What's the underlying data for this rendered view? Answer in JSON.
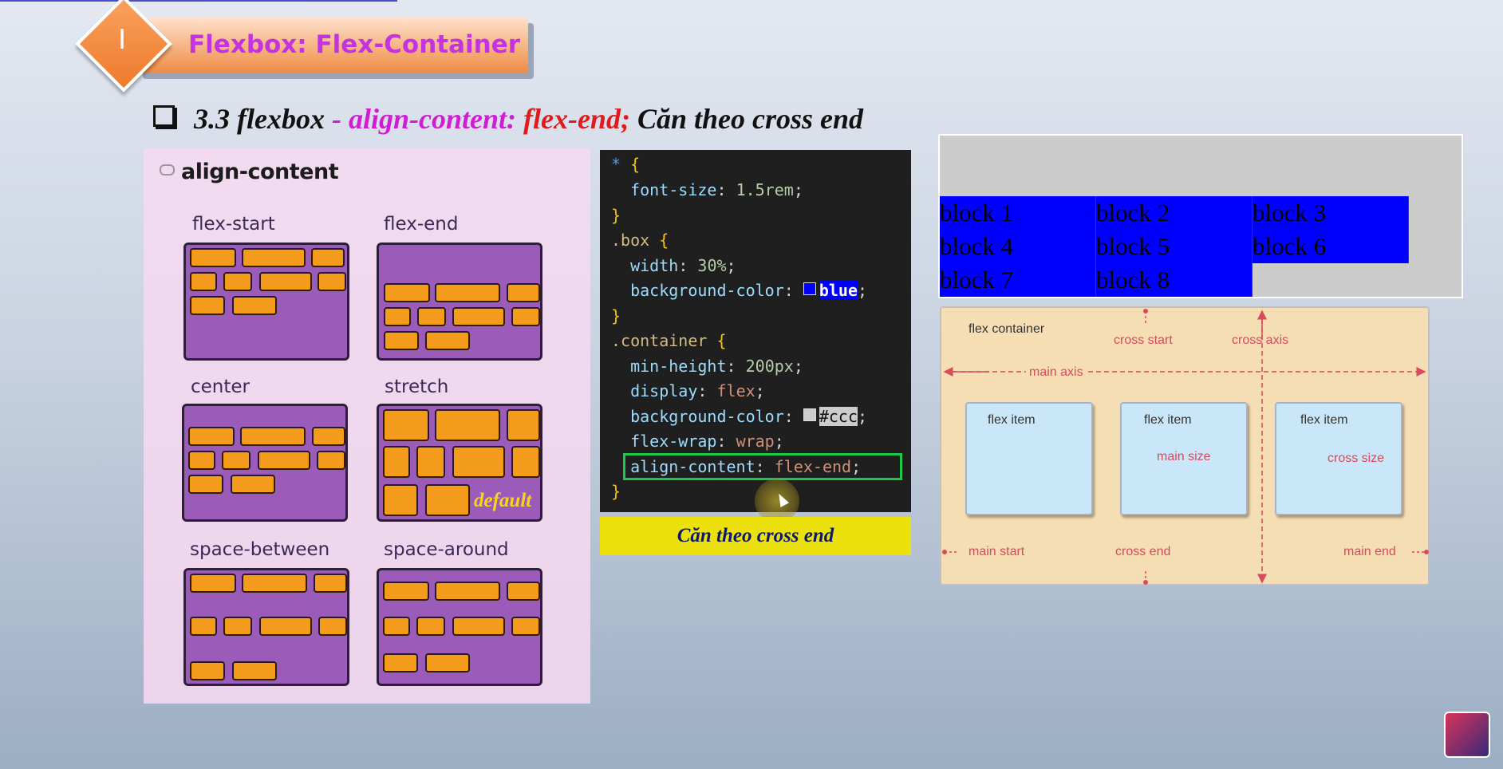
{
  "header": {
    "section_number": "I",
    "title": "Flexbox: Flex-Container"
  },
  "subtitle": {
    "prefix": "3.3 flexbox",
    "dash": " - ",
    "property": "align-content: ",
    "value": "flex-end;",
    "description": " Căn theo cross end"
  },
  "illustration": {
    "heading": "align-content",
    "panels": [
      {
        "label": "flex-start"
      },
      {
        "label": "flex-end"
      },
      {
        "label": "center"
      },
      {
        "label": "stretch",
        "note": "default"
      },
      {
        "label": "space-between"
      },
      {
        "label": "space-around"
      }
    ]
  },
  "code": {
    "lines": [
      {
        "sel": "* ",
        "brace": "{"
      },
      {
        "prop": "font-size",
        "val": "1.5rem"
      },
      {
        "brace": "}"
      },
      {
        "sel": ".box ",
        "brace": "{"
      },
      {
        "prop": "width",
        "val": "30%"
      },
      {
        "prop": "background-color",
        "val": "blue"
      },
      {
        "brace": "}"
      },
      {
        "sel": ".container ",
        "brace": "{"
      },
      {
        "prop": "min-height",
        "val": "200px"
      },
      {
        "prop": "display",
        "val": "flex"
      },
      {
        "prop": "background-color",
        "val": "#ccc"
      },
      {
        "prop": "flex-wrap",
        "val": "wrap"
      },
      {
        "prop": "align-content",
        "val": "flex-end"
      },
      {
        "brace": "}"
      }
    ],
    "caption": "Căn theo cross end"
  },
  "demo": {
    "blocks": [
      "block 1",
      "block 2",
      "block 3",
      "block 4",
      "block 5",
      "block 6",
      "block 7",
      "block 8"
    ],
    "container_color": "#cccccc",
    "block_color": "#0000ff"
  },
  "diagram": {
    "container_label": "flex container",
    "cross_start": "cross start",
    "cross_axis": "cross axis",
    "main_axis": "main axis",
    "item_label": "flex item",
    "main_size": "main size",
    "cross_size": "cross size",
    "main_start": "main start",
    "cross_end": "cross end",
    "main_end": "main end"
  },
  "colors": {
    "title_accent": "#c433e0",
    "highlight": "#19c94a",
    "caption_bg": "#ece00d"
  }
}
